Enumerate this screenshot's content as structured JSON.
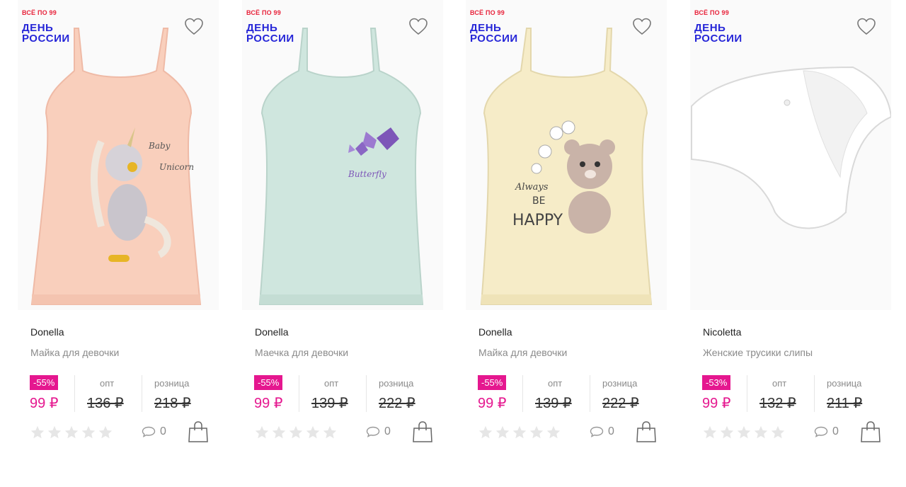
{
  "products": [
    {
      "promo_top": "ВСЁ ПО 99",
      "promo_main": "ДЕНЬ РОССИИ",
      "brand": "Donella",
      "title": "Майка для девочки",
      "discount": "-55%",
      "price": "99 ₽",
      "opt_label": "опт",
      "opt_price": "136 ₽",
      "retail_label": "розница",
      "retail_price": "218 ₽",
      "rating": 0,
      "comments": "0",
      "image_color": "#f9cfbc",
      "print_text": "Baby Unicorn"
    },
    {
      "promo_top": "ВСЁ ПО 99",
      "promo_main": "ДЕНЬ РОССИИ",
      "brand": "Donella",
      "title": "Маечка для девочки",
      "discount": "-55%",
      "price": "99 ₽",
      "opt_label": "опт",
      "opt_price": "139 ₽",
      "retail_label": "розница",
      "retail_price": "222 ₽",
      "rating": 0,
      "comments": "0",
      "image_color": "#cfe6de",
      "print_text": "Butterfly"
    },
    {
      "promo_top": "ВСЁ ПО 99",
      "promo_main": "ДЕНЬ РОССИИ",
      "brand": "Donella",
      "title": "Майка для девочки",
      "discount": "-55%",
      "price": "99 ₽",
      "opt_label": "опт",
      "opt_price": "139 ₽",
      "retail_label": "розница",
      "retail_price": "222 ₽",
      "rating": 0,
      "comments": "0",
      "image_color": "#f6ecc8",
      "print_text": "ALWAYS BE HAPPY"
    },
    {
      "promo_top": "ВСЁ ПО 99",
      "promo_main": "ДЕНЬ РОССИИ",
      "brand": "Nicoletta",
      "title": "Женские трусики слипы",
      "discount": "-53%",
      "price": "99 ₽",
      "opt_label": "опт",
      "opt_price": "132 ₽",
      "retail_label": "розница",
      "retail_price": "211 ₽",
      "rating": 0,
      "comments": "0",
      "image_color": "#ffffff",
      "print_text": ""
    }
  ],
  "colors": {
    "accent": "#e5178f",
    "promo_red": "#e8233b",
    "promo_blue": "#2626d8"
  },
  "icons": [
    "heart-icon",
    "star-icon",
    "comment-icon",
    "shopping-bag-icon"
  ]
}
